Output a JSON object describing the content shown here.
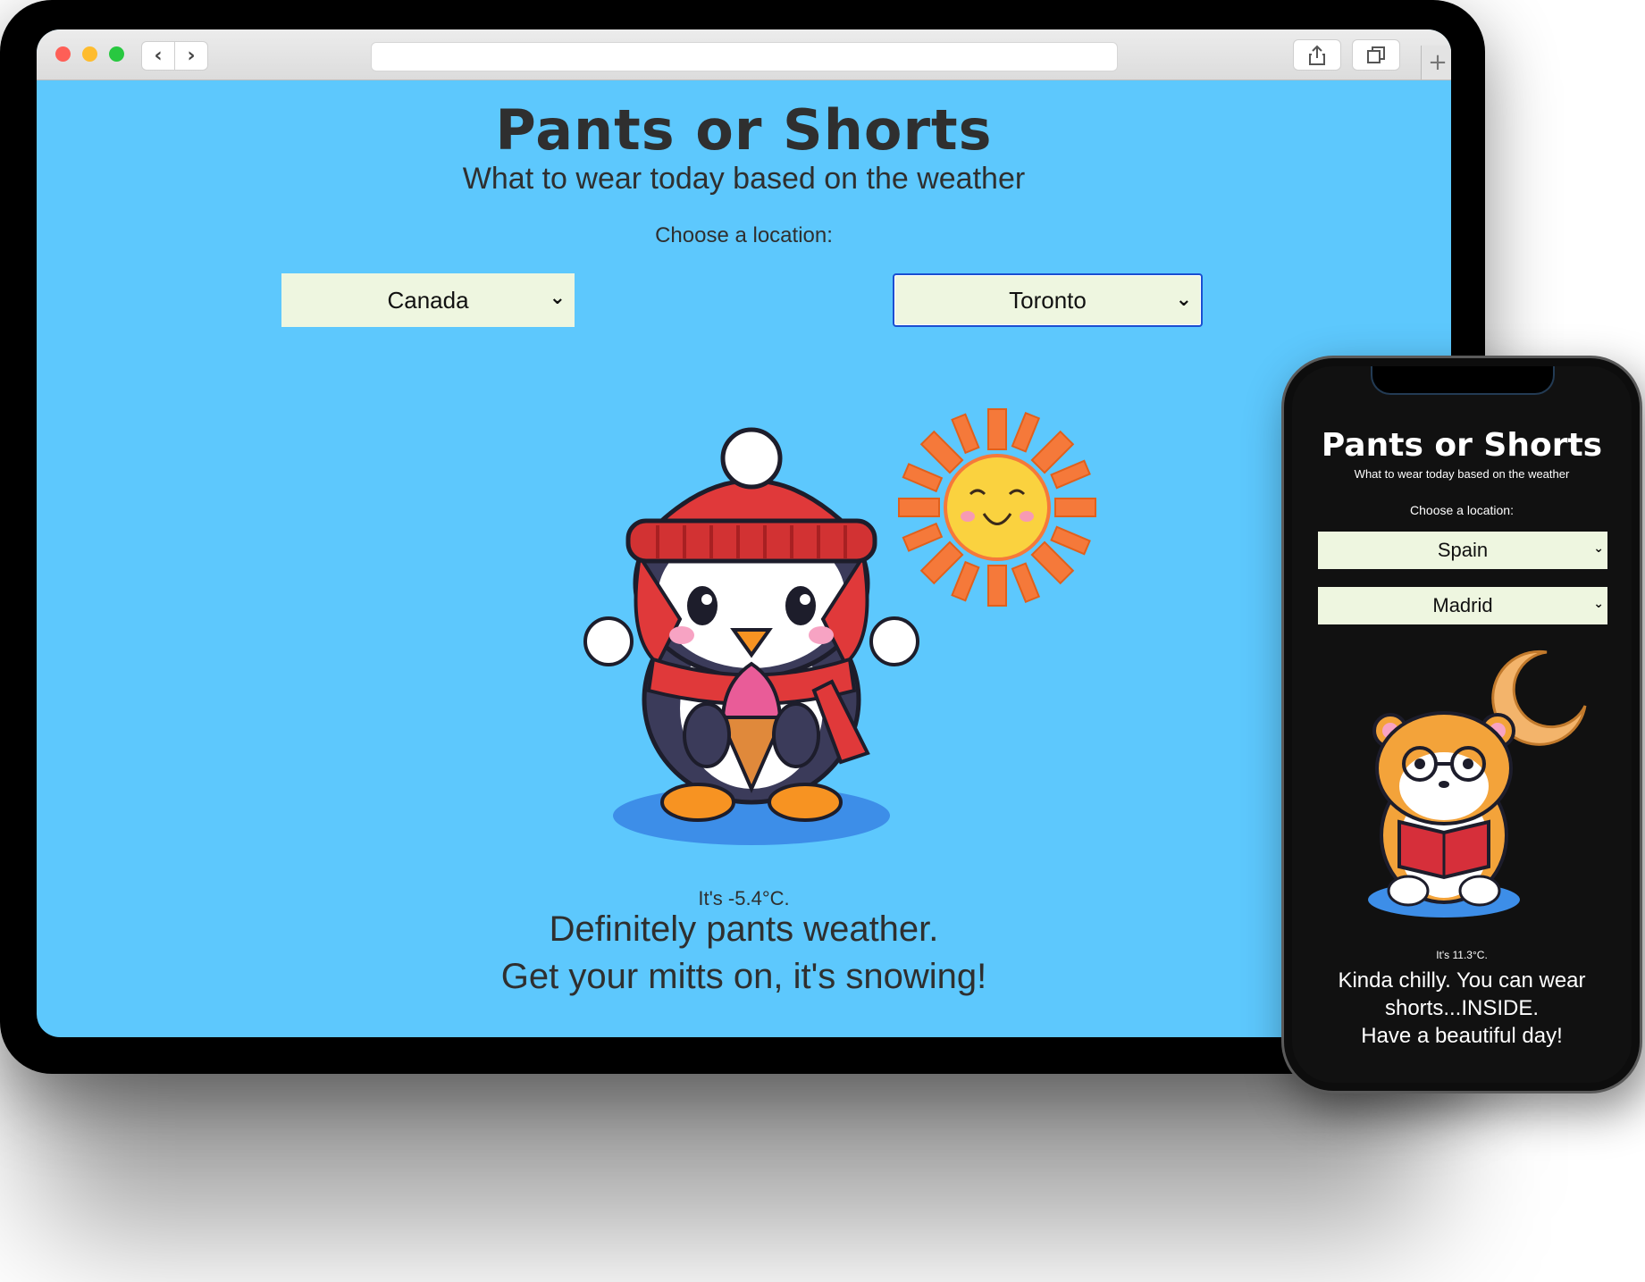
{
  "tablet": {
    "browser": {
      "url": "",
      "back_label": "‹",
      "forward_label": "›",
      "new_tab_label": "+"
    },
    "page": {
      "title": "Pants or Shorts",
      "subtitle": "What to wear today based on the weather",
      "choose_label": "Choose a location:",
      "country_value": "Canada",
      "city_value": "Toronto",
      "temperature_text": "It's -5.4°C.",
      "message_line1": "Definitely pants weather.",
      "message_line2": "Get your mitts on, it's snowing!"
    },
    "colors": {
      "background": "#5dc8fd",
      "select_bg": "#eef6e0",
      "text": "#2f2f2f"
    }
  },
  "phone": {
    "page": {
      "title": "Pants or Shorts",
      "subtitle": "What to wear today based on the weather",
      "choose_label": "Choose a location:",
      "country_value": "Spain",
      "city_value": "Madrid",
      "temperature_text": "It's 11.3°C.",
      "message_line1": "Kinda chilly. You can wear shorts...INSIDE.",
      "message_line2": "Have a beautiful day!"
    },
    "colors": {
      "background": "#111111",
      "select_bg": "#eef6e0",
      "text": "#ffffff"
    }
  },
  "icons": {
    "tablet_illustration": "penguin-with-ice-cream-icon",
    "tablet_weather": "sun-icon",
    "phone_illustration": "hamster-reading-icon",
    "phone_weather": "crescent-moon-icon"
  }
}
